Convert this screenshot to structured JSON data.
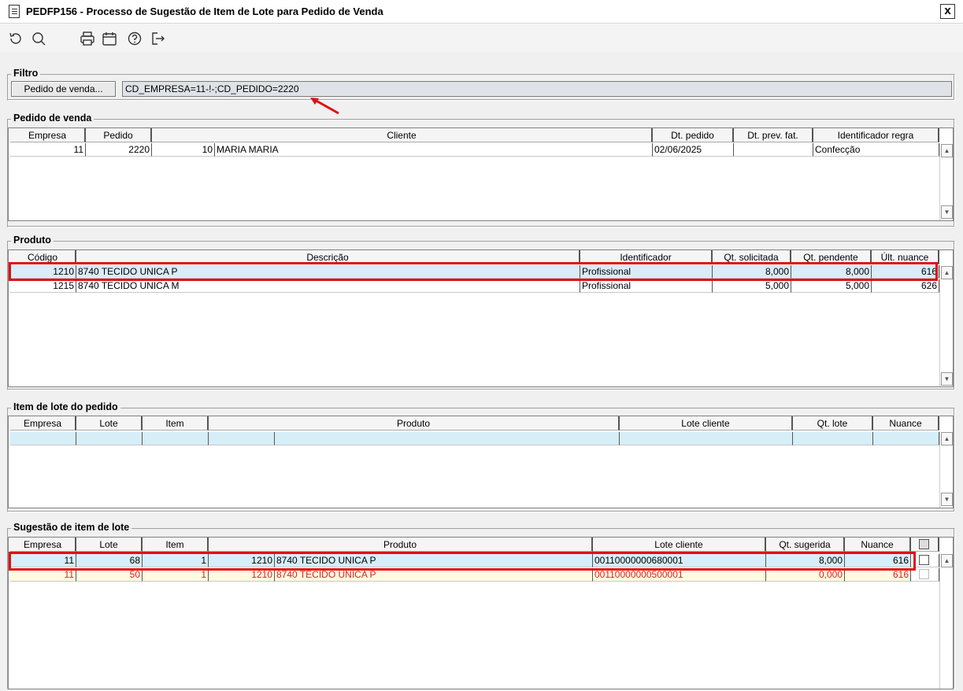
{
  "window": {
    "title": "PEDFP156 - Processo de Sugestão de Item de Lote para Pedido de Venda",
    "close_label": "x"
  },
  "toolbar": {
    "icons": [
      "refresh-icon",
      "search-icon",
      "print-icon",
      "calendar-icon",
      "help-icon",
      "exit-icon"
    ]
  },
  "filter": {
    "legend": "Filtro",
    "button_label": "Pedido de venda...",
    "value": "CD_EMPRESA=11-!-;CD_PEDIDO=2220"
  },
  "pedido": {
    "legend": "Pedido de venda",
    "columns": [
      "Empresa",
      "Pedido",
      "Cliente",
      "Dt. pedido",
      "Dt. prev. fat.",
      "Identificador regra"
    ],
    "rows": [
      {
        "empresa": "11",
        "pedido": "2220",
        "cliente_cod": "10",
        "cliente_nome": "MARIA MARIA",
        "dt_pedido": "02/06/2025",
        "dt_prev": "",
        "regra": "Confecção"
      }
    ]
  },
  "produto": {
    "legend": "Produto",
    "columns": [
      "Código",
      "Descrição",
      "Identificador",
      "Qt. solicitada",
      "Qt. pendente",
      "Últ. nuance"
    ],
    "rows": [
      {
        "codigo": "1210",
        "descricao": "8740 TECIDO UNICA P",
        "identificador": "Profissional",
        "qt_solicitada": "8,000",
        "qt_pendente": "8,000",
        "nuance": "616"
      },
      {
        "codigo": "1215",
        "descricao": "8740 TECIDO UNICA M",
        "identificador": "Profissional",
        "qt_solicitada": "5,000",
        "qt_pendente": "5,000",
        "nuance": "626"
      }
    ]
  },
  "item_lote": {
    "legend": "Item de lote do pedido",
    "columns": [
      "Empresa",
      "Lote",
      "Item",
      "Produto",
      "Lote cliente",
      "Qt. lote",
      "Nuance"
    ]
  },
  "sugestao": {
    "legend": "Sugestão de item de lote",
    "columns": [
      "Empresa",
      "Lote",
      "Item",
      "Produto",
      "Lote cliente",
      "Qt. sugerida",
      "Nuance"
    ],
    "rows": [
      {
        "empresa": "11",
        "lote": "68",
        "item": "1",
        "produto_cod": "1210",
        "produto_desc": "8740 TECIDO UNICA P",
        "lote_cliente": "00110000000680001",
        "qt": "8,000",
        "nuance": "616",
        "checked": false
      },
      {
        "empresa": "11",
        "lote": "50",
        "item": "1",
        "produto_cod": "1210",
        "produto_desc": "8740 TECIDO UNICA P",
        "lote_cliente": "00110000000500001",
        "qt": "0,000",
        "nuance": "616",
        "checked": false
      }
    ]
  },
  "colors": {
    "highlight": "#e01010",
    "selected_row": "#d6eef8",
    "warning_row_bg": "#fffbe0",
    "warning_row_text": "#e02020"
  }
}
